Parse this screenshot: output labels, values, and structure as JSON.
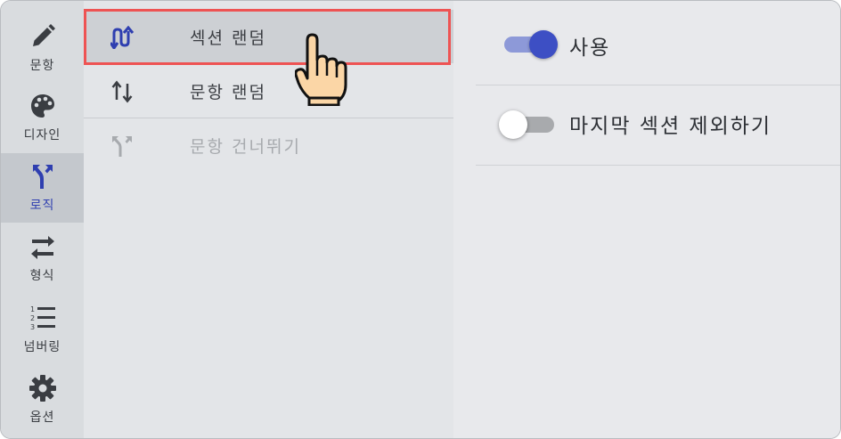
{
  "sidebar": {
    "items": [
      {
        "label": "문항",
        "icon": "pencil-icon",
        "active": false
      },
      {
        "label": "디자인",
        "icon": "palette-icon",
        "active": false
      },
      {
        "label": "로직",
        "icon": "fork-icon",
        "active": true
      },
      {
        "label": "형식",
        "icon": "swap-arrows-icon",
        "active": false
      },
      {
        "label": "넘버링",
        "icon": "numbered-list-icon",
        "active": false
      },
      {
        "label": "옵션",
        "icon": "gear-icon",
        "active": false
      }
    ]
  },
  "menu": {
    "items": [
      {
        "label": "섹션 랜덤",
        "icon": "section-random-icon",
        "state": "selected"
      },
      {
        "label": "문항 랜덤",
        "icon": "question-random-icon",
        "state": "normal"
      },
      {
        "label": "문항 건너뛰기",
        "icon": "skip-logic-icon",
        "state": "disabled"
      }
    ]
  },
  "settings": {
    "rows": [
      {
        "label": "사용",
        "toggle": "on"
      },
      {
        "label": "마지막 섹션 제외하기",
        "toggle": "off"
      }
    ]
  },
  "colors": {
    "accent": "#3d4fc4",
    "highlight_border": "#ee5353",
    "sidebar_bg": "#d9dcdf",
    "content_bg": "#e8e9ec"
  }
}
